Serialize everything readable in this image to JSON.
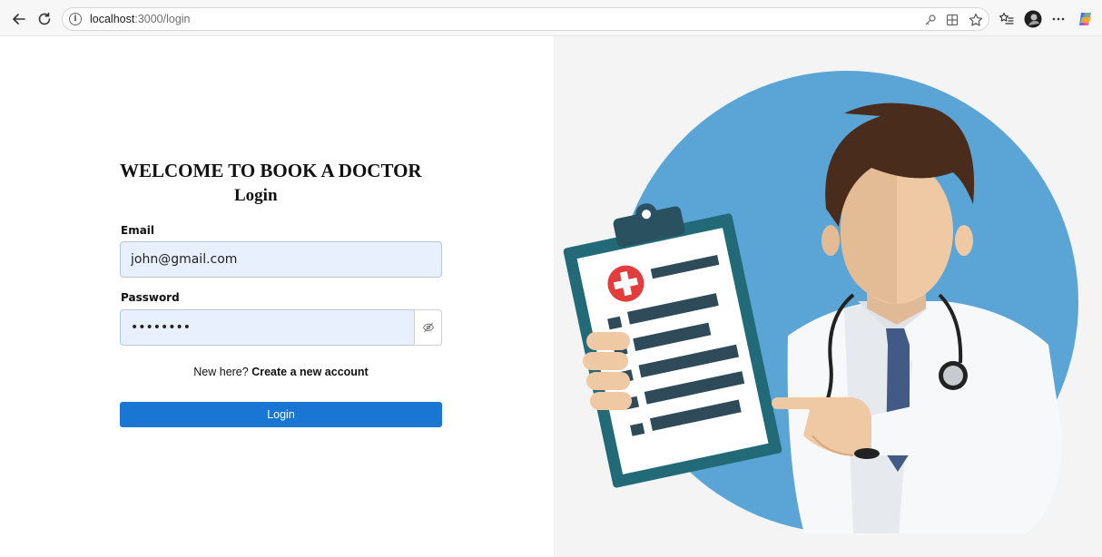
{
  "browser": {
    "url_host": "localhost",
    "url_path": ":3000/login",
    "info_symbol": "i"
  },
  "form": {
    "heading": "WELCOME TO BOOK A DOCTOR",
    "subheading": "Login",
    "email_label": "Email",
    "email_value": "john@gmail.com",
    "password_label": "Password",
    "password_value": "••••••••",
    "new_here_text": "New here?",
    "create_account_link": "Create a new account",
    "login_button": "Login"
  },
  "colors": {
    "primary_button": "#1976d2",
    "input_autofill_bg": "#e8f0fe",
    "illustration_circle": "#5aa5d6",
    "clipboard_frame": "#236a78"
  },
  "icons": {
    "back": "back-arrow-icon",
    "refresh": "refresh-icon",
    "password_toggle": "eye-off-icon"
  }
}
